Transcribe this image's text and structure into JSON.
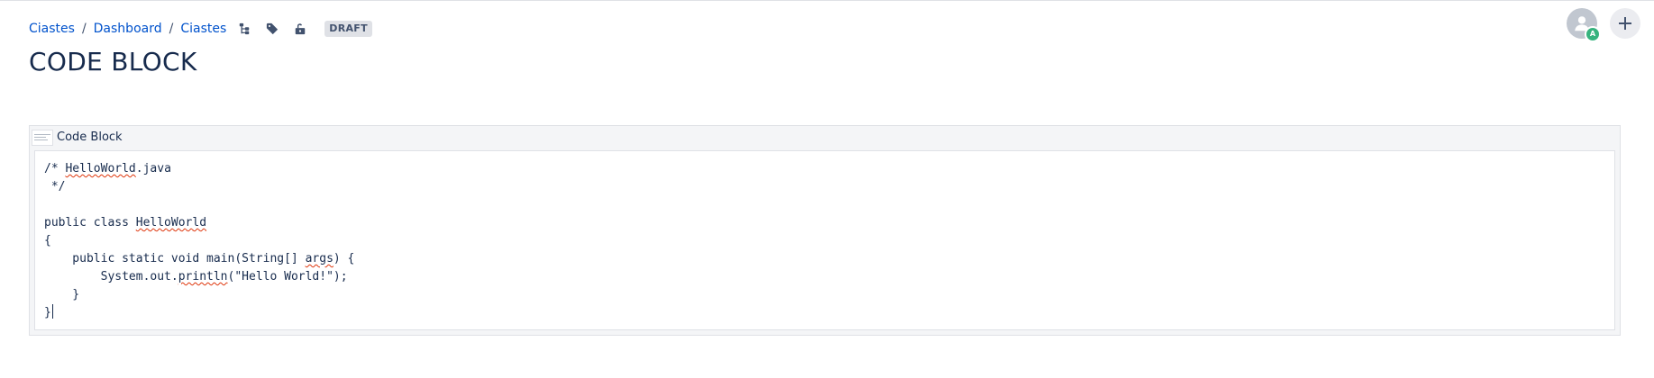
{
  "breadcrumb": {
    "items": [
      {
        "label": "Ciastes"
      },
      {
        "label": "Dashboard"
      },
      {
        "label": "Ciastes"
      }
    ],
    "separator": "/",
    "icons": [
      "page-tree-icon",
      "tag-icon",
      "unlock-icon"
    ]
  },
  "status": {
    "label": "DRAFT"
  },
  "page": {
    "title": "CODE BLOCK"
  },
  "header_actions": {
    "avatar_badge": "A",
    "avatar_icon": "user-icon",
    "add_icon": "plus-icon"
  },
  "macro": {
    "title": "Code Block",
    "code_lines": [
      "/* HelloWorld.java",
      " */",
      "",
      "public class HelloWorld",
      "{",
      "    public static void main(String[] args) {",
      "        System.out.println(\"Hello World!\");",
      "    }",
      "}"
    ],
    "spellcheck_words": [
      "HelloWorld",
      "args",
      "println"
    ]
  },
  "colors": {
    "link": "#0052cc",
    "text": "#172b4d",
    "badge_bg": "#dfe1e6",
    "presence": "#36b37e",
    "spellcheck": "#de350b"
  }
}
